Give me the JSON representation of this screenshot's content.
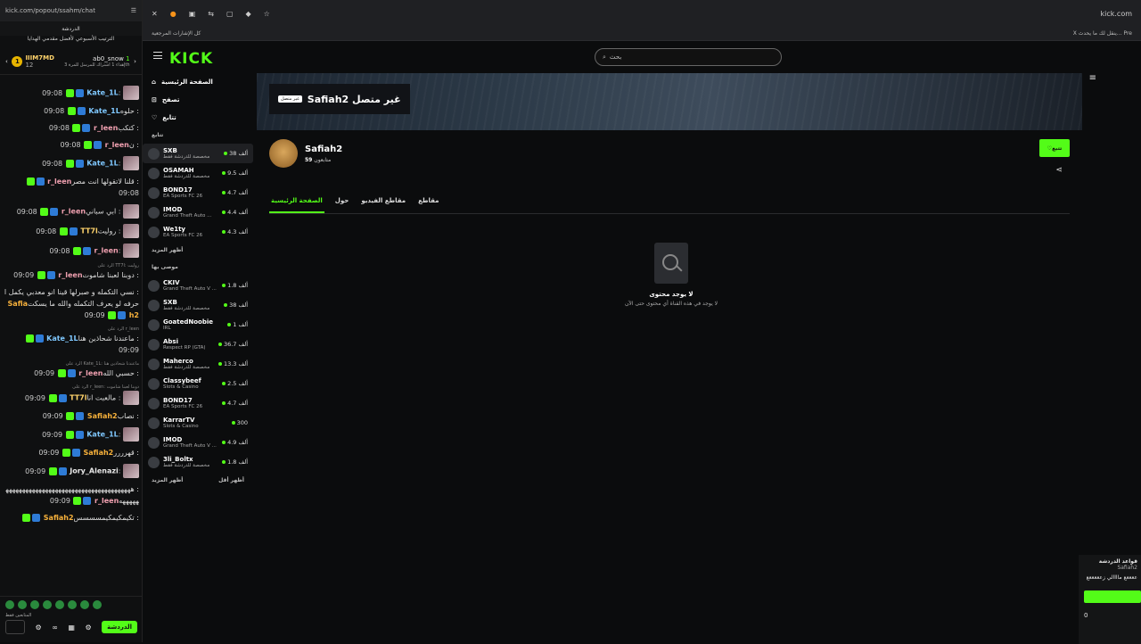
{
  "chat_window": {
    "url": "kick.com/popout/ssahm/chat",
    "title": "الدردشة",
    "pinned": "الترتيب الأسبوعي لأفضل مقدمي الهدايا",
    "leaderboard": {
      "rank1": {
        "name": "IIIM7MD",
        "count": "12",
        "badge": "1"
      },
      "rank2": {
        "name": "ab0_snow",
        "sub": "إهداء 1 اشتراك للمرسل للمرة 3th",
        "count": "1"
      }
    },
    "messages": [
      {
        "time": "09:08",
        "user": "Kate_1L",
        "color": "#7fc8ff",
        "text": ":",
        "emote": true
      },
      {
        "time": "09:08",
        "user": "Kate_1L",
        "color": "#7fc8ff",
        "text": ": حلوه"
      },
      {
        "time": "09:08",
        "user": "r_leen",
        "color": "#f0a0b0",
        "text": ": كتكب"
      },
      {
        "time": "09:08",
        "user": "r_leen",
        "color": "#f0a0b0",
        "text": ": ن"
      },
      {
        "time": "09:08",
        "user": "Kate_1L",
        "color": "#7fc8ff",
        "text": ":",
        "emote": true
      },
      {
        "time": "09:08",
        "user": "r_leen",
        "color": "#f0a0b0",
        "text": ": قلنا لاتقولها انت مصر"
      },
      {
        "time": "09:08",
        "user": "r_leen",
        "color": "#f0a0b0",
        "text": ": ابي سباني",
        "emote": true
      },
      {
        "time": "09:08",
        "user": "TT7l",
        "color": "#ffd36b",
        "text": ": روليت",
        "emote": true
      },
      {
        "time": "09:08",
        "user": "r_leen",
        "color": "#f0a0b0",
        "text": ":",
        "emote": true
      },
      {
        "time": "09:09",
        "user": "r_leen",
        "color": "#f0a0b0",
        "reply": "الرد على TT7l: روليت",
        "text": ": دوبنا لعبنا شاموت"
      },
      {
        "time": "09:09",
        "user": "Safiah2",
        "color": "#f7b13b",
        "text": ": نسي التكمله و صبرلها قينا انو معدبي يكمل احرفه لو يعرف التكمله والله ما يسكت"
      },
      {
        "time": "09:09",
        "user": "Kate_1L",
        "color": "#7fc8ff",
        "reply": "الرد على r_leen",
        "text": ": ماعندنا شحاذين هنا"
      },
      {
        "time": "09:09",
        "user": "r_leen",
        "color": "#f0a0b0",
        "reply": "الرد على Kate_1L: ماعندنا شحاذين هنا",
        "text": ": حسبي الله"
      },
      {
        "time": "09:09",
        "user": "TT7l",
        "color": "#ffd36b",
        "reply": "الرد على r_leen: دوبنا لعبنا شاموت",
        "text": ": مالعبت انا",
        "emote": true
      },
      {
        "time": "09:09",
        "user": "Safiah2",
        "color": "#f7b13b",
        "text": ": نصاب"
      },
      {
        "time": "09:09",
        "user": "Kate_1L",
        "color": "#7fc8ff",
        "text": ":",
        "emote": true
      },
      {
        "time": "09:09",
        "user": "Safiah2",
        "color": "#f7b13b",
        "text": ": قهرررر"
      },
      {
        "time": "09:09",
        "user": "Jory_Alenazi",
        "color": "#e8e8e8",
        "text": ":",
        "emote": true
      },
      {
        "time": "09:09",
        "user": "r_leen",
        "color": "#f0a0b0",
        "text": ": ههههههههههههههههههههههههههههههههههههههههههههه"
      },
      {
        "time": "",
        "user": "Safiah2",
        "color": "#f7b13b",
        "text": ": تكيمكيمكيمسسسس"
      }
    ],
    "followers_only": "المتابعين فقط",
    "send_label": "الدردشة"
  },
  "browser": {
    "domain": "kick.com",
    "bookmarks_label": "كل الإشارات المرجعية",
    "notice": "ينقل لك ما يحدث...",
    "notice_close": "X",
    "pre": "Pre"
  },
  "kick": {
    "logo": "KICK",
    "search_placeholder": "بحث",
    "nav": [
      {
        "label": "الصفحة الرئيسية",
        "icon": "home-icon"
      },
      {
        "label": "تصفح",
        "icon": "browse-icon"
      },
      {
        "label": "تتابع",
        "icon": "heart-icon"
      }
    ],
    "following_title": "تتابع",
    "following": [
      {
        "name": "SXB",
        "cat": "مخصصة للدردشة فقط",
        "viewers": "38 ألف"
      },
      {
        "name": "OSAMAH",
        "cat": "مخصصة للدردشة فقط",
        "viewers": "9.5 ألف"
      },
      {
        "name": "BOND17",
        "cat": "EA Sports FC 26",
        "viewers": "4.7 ألف"
      },
      {
        "name": "IMOD",
        "cat": "Grand Theft Auto ...",
        "viewers": "4.4 ألف"
      },
      {
        "name": "We1ty",
        "cat": "EA Sports FC 26",
        "viewers": "4.3 ألف"
      }
    ],
    "show_more": "أظهر المزيد",
    "recommended_title": "موصى بها",
    "recommended": [
      {
        "name": "CKIV",
        "cat": "Grand Theft Auto V ...",
        "viewers": "1.8 ألف"
      },
      {
        "name": "SXB",
        "cat": "مخصصة للدردشة فقط",
        "viewers": "38 ألف"
      },
      {
        "name": "GoatedNoobie",
        "cat": "IRL",
        "viewers": "1 ألف"
      },
      {
        "name": "Absi",
        "cat": "Respect RP (GTA)",
        "viewers": "36.7 ألف"
      },
      {
        "name": "Maherco",
        "cat": "مخصصة للدردشة فقط",
        "viewers": "13.3 ألف"
      },
      {
        "name": "Classybeef",
        "cat": "Slots & Casino",
        "viewers": "2.5 ألف"
      },
      {
        "name": "BOND17",
        "cat": "EA Sports FC 26",
        "viewers": "4.7 ألف"
      },
      {
        "name": "KarrarTV",
        "cat": "Slots & Casino",
        "viewers": "300"
      },
      {
        "name": "IMOD",
        "cat": "Grand Theft Auto V ...",
        "viewers": "4.9 ألف"
      },
      {
        "name": "3li_Boltx",
        "cat": "مخصصة للدردشة فقط",
        "viewers": "1.8 ألف"
      }
    ],
    "show_more2": "أظهر المزيد",
    "show_less": "أظهر أقل",
    "banner_title": "غير متصل Safiah2",
    "banner_tag": "غير متصل",
    "profile": {
      "name": "Safiah2",
      "followers_count": "59",
      "followers_label": "متابعون"
    },
    "follow_label": "تتبع",
    "tabs": [
      "الصفحة الرئيسية",
      "حول",
      "مقاطع الفيديو",
      "مقاطع"
    ],
    "empty_title": "لا يوجد محتوى",
    "empty_sub": "لا يوجد في هذه القناة أي محتوى حتى الآن",
    "chat_rules": {
      "title": "قواعد الدردشة",
      "user": "Safiah2",
      "line": "ععععع ماااالي زعععععع"
    },
    "viewer_count": "0"
  }
}
